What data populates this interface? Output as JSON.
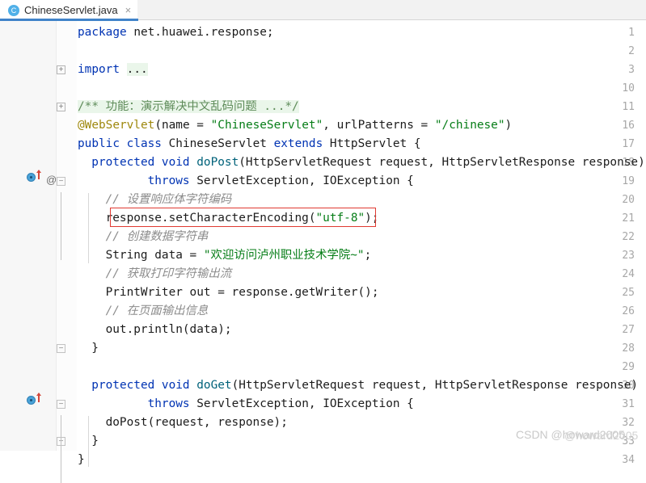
{
  "window": {
    "app": "IntelliJ IDEA Editor"
  },
  "tab": {
    "icon": "java-class-icon",
    "label": "ChineseServlet.java",
    "close": "×"
  },
  "editor": {
    "gutter_icons": {
      "override_marker": "override-method-icon",
      "annotation_marker": "@"
    },
    "lines": [
      {
        "no": "1",
        "indent": 0,
        "fold": "none",
        "segments": [
          {
            "t": "package ",
            "c": "kw"
          },
          {
            "t": "net.huawei.response;",
            "c": "plain"
          }
        ]
      },
      {
        "no": "2",
        "indent": 0,
        "fold": "none",
        "segments": []
      },
      {
        "no": "3",
        "indent": 0,
        "fold": "plus",
        "segments": [
          {
            "t": "import ",
            "c": "kw"
          },
          {
            "t": "...",
            "c": "plain fold"
          }
        ]
      },
      {
        "no": "10",
        "indent": 0,
        "fold": "none",
        "segments": []
      },
      {
        "no": "11",
        "indent": 0,
        "fold": "plus",
        "segments": [
          {
            "t": "/** 功能：演示解决中文乱码问题 ...*/",
            "c": "jdoc fold"
          }
        ]
      },
      {
        "no": "16",
        "indent": 0,
        "fold": "none",
        "segments": [
          {
            "t": "@WebServlet",
            "c": "ann"
          },
          {
            "t": "(name = ",
            "c": "plain"
          },
          {
            "t": "\"ChineseServlet\"",
            "c": "str"
          },
          {
            "t": ", urlPatterns = ",
            "c": "plain"
          },
          {
            "t": "\"/chinese\"",
            "c": "str"
          },
          {
            "t": ")",
            "c": "plain"
          }
        ]
      },
      {
        "no": "17",
        "indent": 0,
        "fold": "none",
        "segments": [
          {
            "t": "public class ",
            "c": "kw"
          },
          {
            "t": "ChineseServlet ",
            "c": "plain"
          },
          {
            "t": "extends ",
            "c": "kw"
          },
          {
            "t": "HttpServlet {",
            "c": "plain"
          }
        ]
      },
      {
        "no": "18",
        "indent": 1,
        "fold": "none",
        "segments": [
          {
            "t": "protected void ",
            "c": "kw"
          },
          {
            "t": "doPost",
            "c": "mtd"
          },
          {
            "t": "(HttpServletRequest request, HttpServletResponse response)",
            "c": "plain"
          }
        ]
      },
      {
        "no": "19",
        "indent": 1,
        "fold": "minus",
        "segments": [
          {
            "t": "        throws ",
            "c": "kw"
          },
          {
            "t": "ServletException, IOException {",
            "c": "plain"
          }
        ]
      },
      {
        "no": "20",
        "indent": 2,
        "fold": "none",
        "segments": [
          {
            "t": "// 设置响应体字符编码",
            "c": "cmt"
          }
        ]
      },
      {
        "no": "21",
        "indent": 2,
        "fold": "none",
        "segments": [
          {
            "t": "response.setCharacterEncoding(",
            "c": "plain"
          },
          {
            "t": "\"utf-8\"",
            "c": "str"
          },
          {
            "t": ");",
            "c": "plain"
          }
        ]
      },
      {
        "no": "22",
        "indent": 2,
        "fold": "none",
        "segments": [
          {
            "t": "// 创建数据字符串",
            "c": "cmt"
          }
        ]
      },
      {
        "no": "23",
        "indent": 2,
        "fold": "none",
        "segments": [
          {
            "t": "String data = ",
            "c": "plain"
          },
          {
            "t": "\"欢迎访问泸州职业技术学院~\"",
            "c": "str"
          },
          {
            "t": ";",
            "c": "plain"
          }
        ]
      },
      {
        "no": "24",
        "indent": 2,
        "fold": "none",
        "segments": [
          {
            "t": "// 获取打印字符输出流",
            "c": "cmt"
          }
        ]
      },
      {
        "no": "25",
        "indent": 2,
        "fold": "none",
        "segments": [
          {
            "t": "PrintWriter out = response.getWriter();",
            "c": "plain"
          }
        ]
      },
      {
        "no": "26",
        "indent": 2,
        "fold": "none",
        "segments": [
          {
            "t": "// 在页面输出信息",
            "c": "cmt"
          }
        ]
      },
      {
        "no": "27",
        "indent": 2,
        "fold": "none",
        "segments": [
          {
            "t": "out.println(data);",
            "c": "plain"
          }
        ]
      },
      {
        "no": "28",
        "indent": 1,
        "fold": "arrowup",
        "segments": [
          {
            "t": "}",
            "c": "plain"
          }
        ]
      },
      {
        "no": "29",
        "indent": 0,
        "fold": "none",
        "segments": []
      },
      {
        "no": "30",
        "indent": 1,
        "fold": "none",
        "segments": [
          {
            "t": "protected void ",
            "c": "kw"
          },
          {
            "t": "doGet",
            "c": "mtd"
          },
          {
            "t": "(HttpServletRequest request, HttpServletResponse response)",
            "c": "plain"
          }
        ]
      },
      {
        "no": "31",
        "indent": 1,
        "fold": "minus",
        "segments": [
          {
            "t": "        throws ",
            "c": "kw"
          },
          {
            "t": "ServletException, IOException {",
            "c": "plain"
          }
        ]
      },
      {
        "no": "32",
        "indent": 2,
        "fold": "none",
        "segments": [
          {
            "t": "doPost(request, response);",
            "c": "plain"
          }
        ]
      },
      {
        "no": "33",
        "indent": 1,
        "fold": "arrowup",
        "segments": [
          {
            "t": "}",
            "c": "plain"
          }
        ]
      },
      {
        "no": "34",
        "indent": 0,
        "fold": "none",
        "segments": [
          {
            "t": "}",
            "c": "plain"
          }
        ]
      }
    ],
    "highlight_box": {
      "line_no": "21",
      "color": "#e03a32",
      "text": "response.setCharacterEncoding(\"utf-8\");"
    }
  },
  "watermark": {
    "text": "CSDN @howard2005",
    "text_overlay": "@howard2005"
  },
  "colors": {
    "keyword": "#0033b3",
    "string": "#067d17",
    "comment": "#8c8c8c",
    "javadoc": "#5f8c5a",
    "annotation": "#9e880d",
    "method": "#00627a",
    "fold_background": "#eaf6ea",
    "tab_accent": "#4083c9",
    "highlight": "#e03a32"
  }
}
